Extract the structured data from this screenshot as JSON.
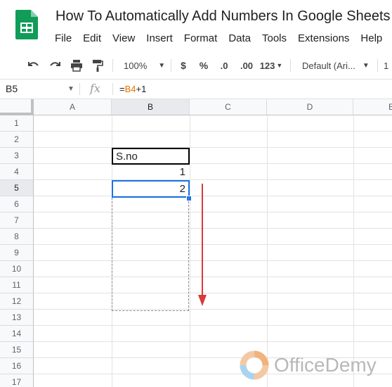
{
  "app": {
    "doc_title": "How To Automatically Add Numbers In Google Sheets",
    "brand_color": "#0f9d58"
  },
  "menu": [
    "File",
    "Edit",
    "View",
    "Insert",
    "Format",
    "Data",
    "Tools",
    "Extensions",
    "Help"
  ],
  "toolbar": {
    "zoom": "100%",
    "currency": "$",
    "percent": "%",
    "decrease_decimal": ".0",
    "increase_decimal": ".00",
    "more_formats": "123",
    "font": "Default (Ari...",
    "font_size": "1"
  },
  "formula_bar": {
    "name_box": "B5",
    "fx": "fx",
    "formula_prefix": "=",
    "formula_ref": "B4",
    "formula_suffix": "+1"
  },
  "sheet": {
    "columns": [
      "A",
      "B",
      "C",
      "D",
      "E"
    ],
    "rows": [
      "1",
      "2",
      "3",
      "4",
      "5",
      "6",
      "7",
      "8",
      "9",
      "10",
      "11",
      "12",
      "13",
      "14",
      "15",
      "16",
      "17"
    ],
    "selected_col": "B",
    "selected_row": "5",
    "cells": {
      "B3": "S.no",
      "B4": "1",
      "B5": "2"
    },
    "selection_color": "#1a73e8",
    "arrow_color": "#d93a3a"
  },
  "watermark": {
    "text": "OfficeDemy"
  }
}
